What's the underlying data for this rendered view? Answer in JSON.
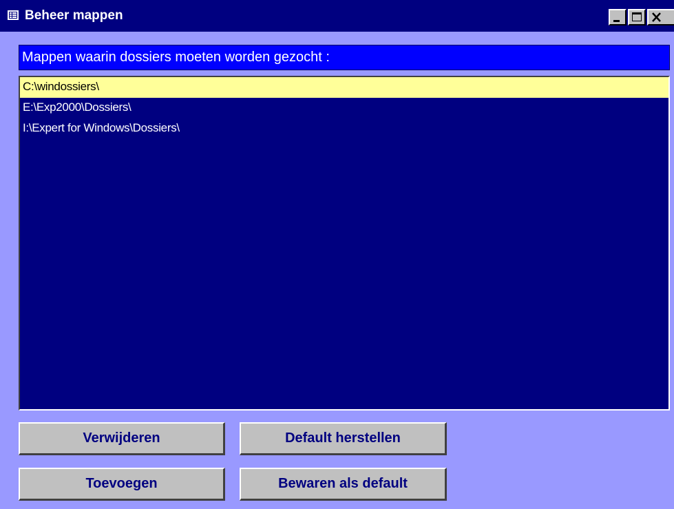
{
  "window": {
    "title": "Beheer mappen",
    "controls": {
      "minimize": "minimize-icon",
      "maximize": "maximize-icon",
      "close": "close-icon"
    }
  },
  "header": {
    "label": "Mappen waarin dossiers moeten worden gezocht :"
  },
  "folders": {
    "items": [
      {
        "path": "C:\\windossiers\\",
        "selected": true
      },
      {
        "path": "E:\\Exp2000\\Dossiers\\",
        "selected": false
      },
      {
        "path": "I:\\Expert for Windows\\Dossiers\\",
        "selected": false
      }
    ]
  },
  "buttons": {
    "delete": "Verwijderen",
    "restore_default": "Default herstellen",
    "add": "Toevoegen",
    "save_default": "Bewaren als default"
  },
  "colors": {
    "title_bar": "#000080",
    "form_background": "#9999FF",
    "header_background": "#0000FF",
    "list_background": "#000080",
    "selected_row": "#FFFF99",
    "button_face": "#C0C0C0",
    "button_text": "#000080"
  }
}
